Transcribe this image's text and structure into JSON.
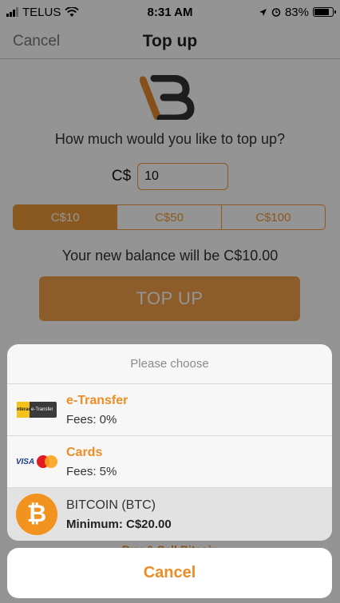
{
  "status_bar": {
    "carrier": "TELUS",
    "time": "8:31 AM",
    "battery": "83%"
  },
  "nav": {
    "cancel_label": "Cancel",
    "title": "Top up"
  },
  "brand": {
    "logo": "bitcoin-well-logo-icon",
    "accent_color": "#ee9a3a"
  },
  "form": {
    "question": "How much would you like to top up?",
    "currency_label": "C$",
    "amount_value": "10",
    "presets": [
      {
        "label": "C$10",
        "selected": true
      },
      {
        "label": "C$50",
        "selected": false
      },
      {
        "label": "C$100",
        "selected": false
      }
    ],
    "balance_text": "Your new balance will be C$10.00",
    "topup_label": "TOP UP"
  },
  "background_link": "Buy & Sell Bitcoin",
  "sheet": {
    "title": "Please choose",
    "options": [
      {
        "icon": "interac-etransfer-icon",
        "title": "e-Transfer",
        "subtitle": "Fees: 0%"
      },
      {
        "icon": "visa-mastercard-icon",
        "title": "Cards",
        "subtitle": "Fees: 5%"
      },
      {
        "icon": "bitcoin-icon",
        "title": "BITCOIN (BTC)",
        "subtitle": "Minimum: C$20.00"
      }
    ],
    "cancel_label": "Cancel"
  },
  "logo_texts": {
    "interac": "Interac",
    "etransfer": "e-Transfer",
    "visa": "VISA",
    "bitcoin_symbol": "₿"
  }
}
